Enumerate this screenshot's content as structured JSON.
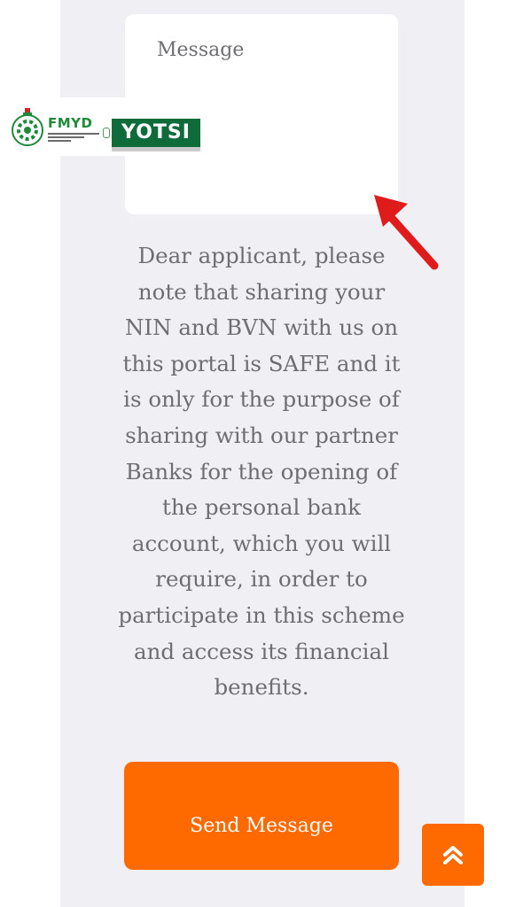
{
  "form": {
    "message_placeholder": "Message",
    "send_label": "Send Message"
  },
  "notice": {
    "text": "Dear applicant, please note that sharing your NIN and BVN with us on this portal is SAFE and it is only for the purpose of sharing with our partner Banks for the opening of the personal bank account, which you will require, in order to participate in this scheme and access its financial benefits."
  },
  "logos": {
    "fmyd_text": "FMYD",
    "ytsi_text": "YOTSI"
  },
  "icons": {
    "scroll_top": "chevron-double-up-icon",
    "annotation": "red-arrow-icon"
  },
  "colors": {
    "accent": "#ff6a00",
    "panel_bg": "#efeff4",
    "arrow_red": "#e01b1b",
    "ytsi_green": "#0f6b3a",
    "fmyd_green": "#1f8a3a"
  }
}
